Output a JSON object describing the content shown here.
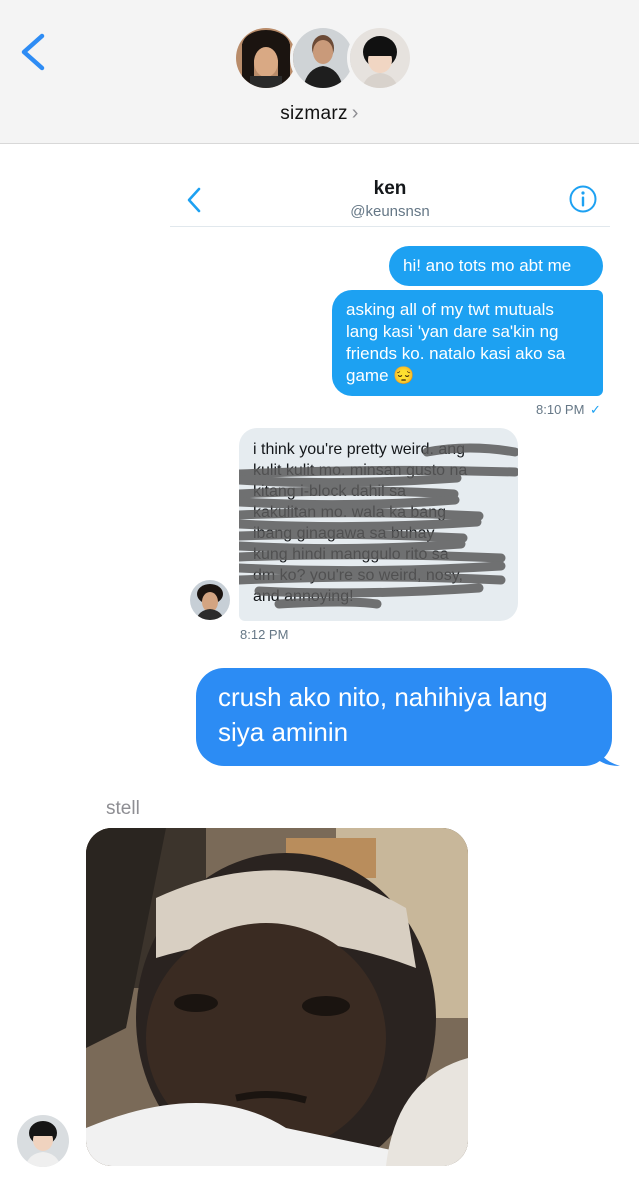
{
  "header": {
    "group_name": "sizmarz",
    "group_chevron": "›",
    "back_icon": "chevron-left-icon",
    "accent": "#2e8cf4"
  },
  "embedded": {
    "name": "ken",
    "handle": "@keunsnsn",
    "info_icon": "info-icon",
    "messages": [
      {
        "sender": "me",
        "text": "hi! ano tots mo abt me"
      },
      {
        "sender": "me",
        "text_lines": [
          "asking all of my twt mutuals",
          "lang kasi 'yan dare sa'kin ng",
          "friends ko. natalo kasi ako sa",
          "game 😔"
        ],
        "time": "8:10 PM",
        "read": "✓"
      },
      {
        "sender": "them",
        "text_lines": [
          "i think you're pretty weird. ang",
          "kulit kulit mo. minsan gusto na",
          "kitang i-block dahil sa",
          "kakulitan mo. wala ka bang",
          "ibang ginagawa sa buhay",
          "kung hindi manggulo rito sa",
          "dm ko? you're so weird, nosy,",
          "and annoying!"
        ],
        "time": "8:12 PM"
      }
    ],
    "tweet_blue": "#1da1f2"
  },
  "imessage": {
    "outgoing_text_lines": [
      "crush ako nito, nahihiya lang",
      "siya aminin"
    ],
    "sender_label": "stell",
    "bubble_blue": "#2c8cf4"
  }
}
